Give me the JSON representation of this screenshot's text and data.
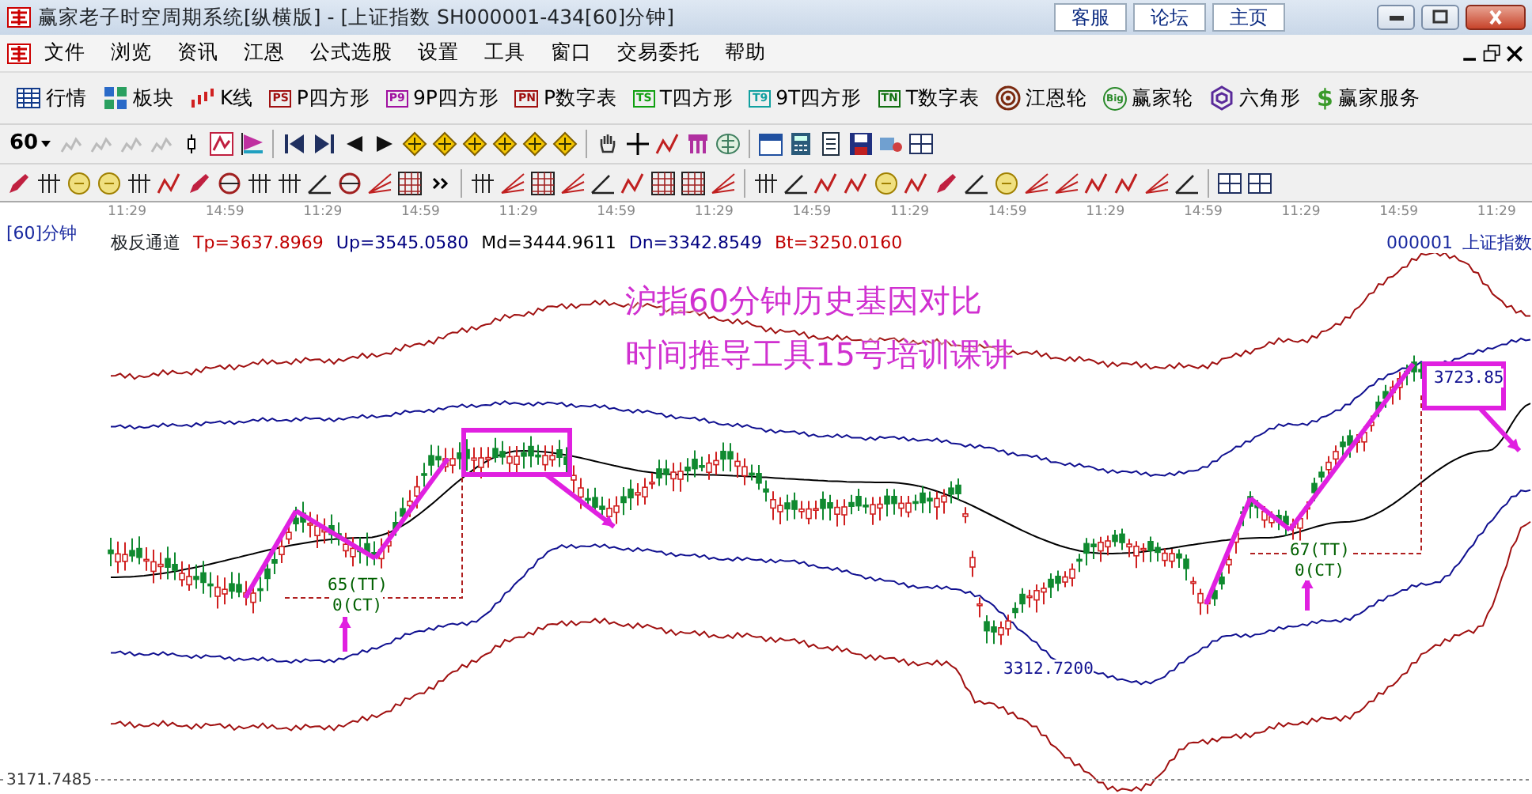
{
  "window": {
    "title": "赢家老子时空周期系统[纵横版] - [上证指数  SH000001-434[60]分钟]",
    "links": [
      "客服",
      "论坛",
      "主页"
    ]
  },
  "menu": [
    "文件",
    "浏览",
    "资讯",
    "江恩",
    "公式选股",
    "设置",
    "工具",
    "窗口",
    "交易委托",
    "帮助"
  ],
  "toolbar": [
    {
      "label": "行情",
      "kind": "table"
    },
    {
      "label": "板块",
      "kind": "blocks"
    },
    {
      "label": "K线",
      "kind": "candles"
    },
    {
      "label": "P四方形",
      "kind": "badge",
      "badge": "PS"
    },
    {
      "label": "9P四方形",
      "kind": "badge",
      "badge": "P9"
    },
    {
      "label": "P数字表",
      "kind": "badge",
      "badge": "PN"
    },
    {
      "label": "T四方形",
      "kind": "badge",
      "badge": "TS"
    },
    {
      "label": "9T四方形",
      "kind": "badge",
      "badge": "T9"
    },
    {
      "label": "T数字表",
      "kind": "badge",
      "badge": "TN"
    },
    {
      "label": "江恩轮",
      "kind": "target"
    },
    {
      "label": "赢家轮",
      "kind": "round",
      "badge": "Big"
    },
    {
      "label": "六角形",
      "kind": "hexagon"
    },
    {
      "label": "赢家服务",
      "kind": "glyph",
      "badge": "$"
    }
  ],
  "period_selector": {
    "value": "60"
  },
  "time_axis": [
    "11:29",
    "14:59",
    "11:29",
    "14:59",
    "11:29",
    "14:59",
    "11:29",
    "14:59",
    "11:29",
    "14:59",
    "11:29",
    "14:59",
    "11:29",
    "14:59",
    "11:29"
  ],
  "chart_header": {
    "period": "[60]分钟",
    "indicator": "极反通道",
    "values": [
      {
        "text": "Tp=3637.8969",
        "color": "#c00000"
      },
      {
        "text": "Up=3545.0580",
        "color": "#000080"
      },
      {
        "text": "Md=3444.9611",
        "color": "#000000"
      },
      {
        "text": "Dn=3342.8549",
        "color": "#000080"
      },
      {
        "text": "Bt=3250.0160",
        "color": "#c00000"
      }
    ],
    "code": "000001",
    "name": "上证指数"
  },
  "chart": {
    "annotation": [
      "沪指60分钟历史基因对比",
      "时间推导工具15号培训课讲"
    ],
    "labels": [
      "65(TT)",
      "0(CT)",
      "67(TT)",
      "0(CT)",
      "3312.7200",
      "3723.85"
    ],
    "bottom_price": "3171.7485"
  }
}
